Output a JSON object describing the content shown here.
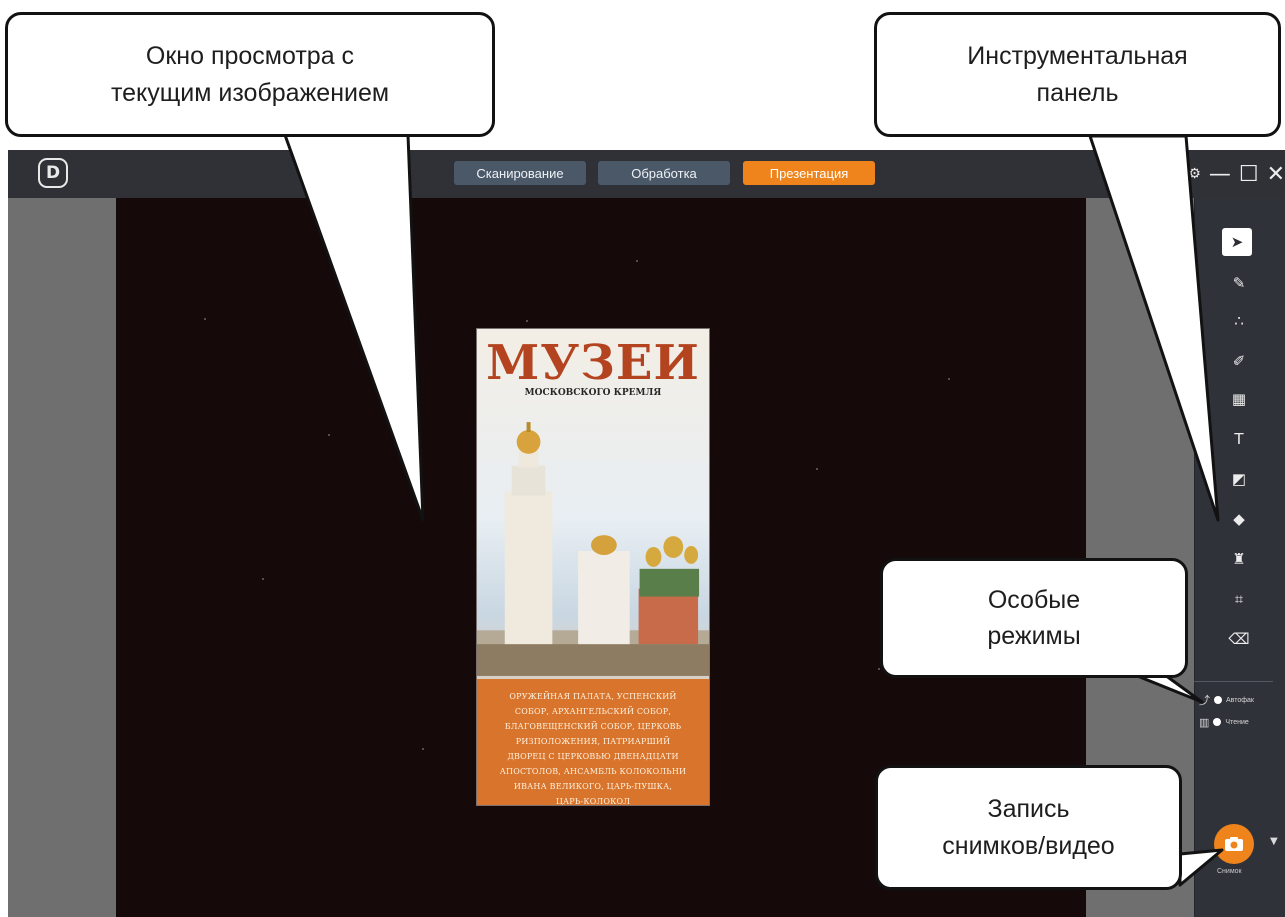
{
  "callouts": {
    "viewer": "Окно просмотра с\nтекущим изображением",
    "toolbar": "Инструментальная\nпанель",
    "modes": "Особые\nрежимы",
    "capture": "Запись\nснимков/видео"
  },
  "titlebar": {
    "logo": "D",
    "tabs": [
      "Сканирование",
      "Обработка",
      "Презентация"
    ],
    "active_tab": "Презентация",
    "window_controls": [
      "settings-icon",
      "minimize-icon",
      "maximize-icon",
      "close-icon"
    ]
  },
  "document": {
    "title": "МУЗЕИ",
    "subtitle": "МОСКОВСКОГО КРЕМЛЯ",
    "band_lines": [
      "ОРУЖЕЙНАЯ ПАЛАТА, УСПЕНСКИЙ",
      "СОБОР, АРХАНГЕЛЬСКИЙ СОБОР,",
      "БЛАГОВЕЩЕНСКИЙ СОБОР, ЦЕРКОВЬ",
      "РИЗПОЛОЖЕНИЯ, ПАТРИАРШИЙ",
      "ДВОРЕЦ С ЦЕРКОВЬЮ ДВЕНАДЦАТИ",
      "АПОСТОЛОВ, АНСАМБЛЬ КОЛОКОЛЬНИ",
      "ИВАНА ВЕЛИКОГО, ЦАРЬ-ПУШКА,",
      "ЦАРЬ-КОЛОКОЛ"
    ]
  },
  "toolbar": {
    "tools": [
      "pointer-icon",
      "pen-icon",
      "laser-pointer-icon",
      "highlighter-icon",
      "mosaic-icon",
      "text-icon",
      "shape-icon",
      "eraser-icon",
      "stamp-icon",
      "crop-icon",
      "clear-icon"
    ],
    "selected_tool": "pointer-icon",
    "modes": [
      {
        "label": "Автофак",
        "icon": "auto-icon"
      },
      {
        "label": "Чтение",
        "icon": "reading-icon"
      }
    ],
    "capture_label": "Снимок"
  },
  "colors": {
    "accent": "#f0841c",
    "titlebar": "#2f3136",
    "viewer": "#150909",
    "tab": "#4b5868"
  }
}
